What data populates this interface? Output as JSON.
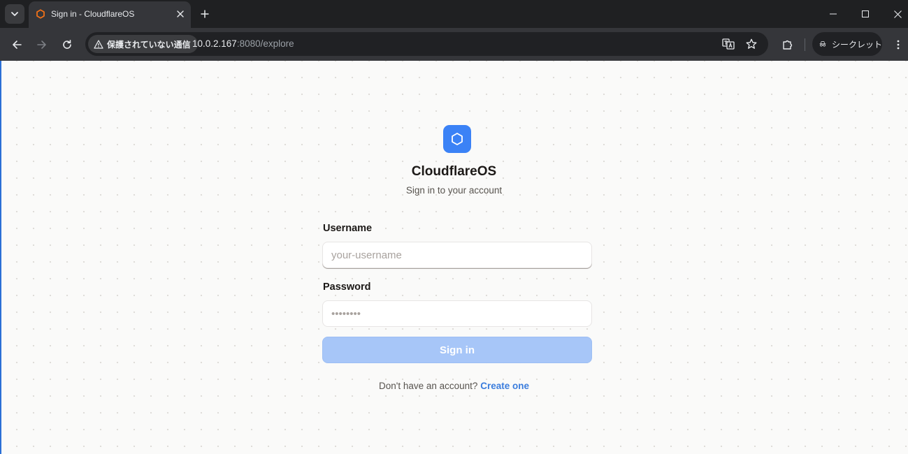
{
  "browser": {
    "tab": {
      "title": "Sign in - CloudflareOS"
    },
    "address_bar": {
      "security_label": "保護されていない通信",
      "url_host": "10.0.2.167",
      "url_rest": ":8080/explore"
    },
    "incognito_label": "シークレット"
  },
  "login": {
    "app_name": "CloudflareOS",
    "subtitle": "Sign in to your account",
    "username_label": "Username",
    "username_placeholder": "your-username",
    "password_label": "Password",
    "password_placeholder": "••••••••",
    "submit_label": "Sign in",
    "signup_prompt": "Don't have an account?",
    "signup_link": "Create one"
  },
  "colors": {
    "accent": "#3b82f6",
    "button_disabled": "#a7c6f8",
    "link": "#3b7ddd",
    "favicon": "#f97316",
    "page_background": "#fafaf9"
  },
  "icons": {
    "tab_favicon": "hexagon-icon",
    "logo": "hexagon-icon",
    "security": "warning-triangle-icon"
  }
}
